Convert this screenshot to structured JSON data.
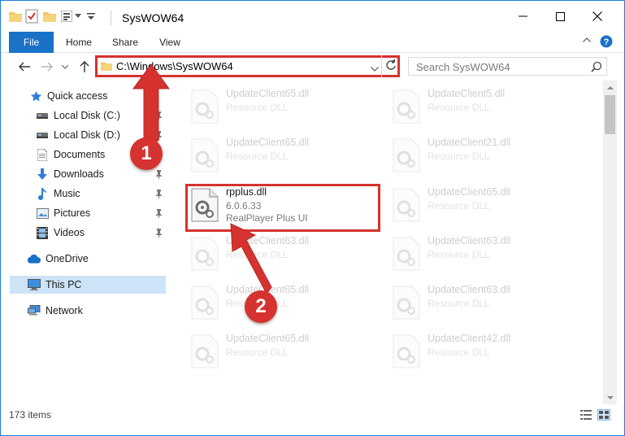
{
  "window": {
    "title": "SysWOW64",
    "controls": {
      "minimize": "minimize",
      "maximize": "maximize",
      "close": "close"
    }
  },
  "ribbon": {
    "tabs": [
      "File",
      "Home",
      "Share",
      "View"
    ]
  },
  "address": {
    "path": "C:\\Windows\\SysWOW64",
    "search_placeholder": "Search SysWOW64"
  },
  "nav": {
    "items": [
      {
        "label": "Quick access",
        "icon": "star-icon",
        "pinned": false
      },
      {
        "label": "Local Disk (C:)",
        "icon": "drive-icon",
        "pinned": true
      },
      {
        "label": "Local Disk (D:)",
        "icon": "drive-icon",
        "pinned": true
      },
      {
        "label": "Documents",
        "icon": "document-icon",
        "pinned": true
      },
      {
        "label": "Downloads",
        "icon": "download-arrow-icon",
        "pinned": true
      },
      {
        "label": "Music",
        "icon": "music-note-icon",
        "pinned": true
      },
      {
        "label": "Pictures",
        "icon": "pictures-icon",
        "pinned": true
      },
      {
        "label": "Videos",
        "icon": "film-icon",
        "pinned": true
      },
      {
        "label": "OneDrive",
        "icon": "cloud-icon",
        "pinned": false
      },
      {
        "label": "This PC",
        "icon": "computer-icon",
        "pinned": false,
        "selected": true
      },
      {
        "label": "Network",
        "icon": "network-icon",
        "pinned": false
      }
    ]
  },
  "files": {
    "left": [
      {
        "name": "UpdateClient65.dll",
        "desc": "Resource DLL"
      },
      {
        "name": "UpdateClient65.dll",
        "desc": "Resource DLL"
      },
      {
        "name": "rpplus.dll",
        "desc": "6.0.6.33",
        "desc2": "RealPlayer Plus UI",
        "highlighted": true
      },
      {
        "name": "UpdateClient63.dll",
        "desc": "Resource DLL"
      },
      {
        "name": "UpdateClient65.dll",
        "desc": "Resource DLL"
      },
      {
        "name": "UpdateClient65.dll",
        "desc": "Resource DLL"
      }
    ],
    "right": [
      {
        "name": "UpdateClient5.dll",
        "desc": "Resource DLL"
      },
      {
        "name": "UpdateClient21.dll",
        "desc": "Resource DLL"
      },
      {
        "name": "UpdateClient65.dll",
        "desc": "Resource DLL"
      },
      {
        "name": "UpdateClient63.dll",
        "desc": "Resource DLL"
      },
      {
        "name": "UpdateClient63.dll",
        "desc": "Resource DLL"
      },
      {
        "name": "UpdateClient42.dll",
        "desc": "Resource DLL"
      }
    ]
  },
  "status": {
    "item_count": "173 items"
  },
  "annotations": {
    "step1": "1",
    "step2": "2",
    "color": "#d6322f"
  }
}
